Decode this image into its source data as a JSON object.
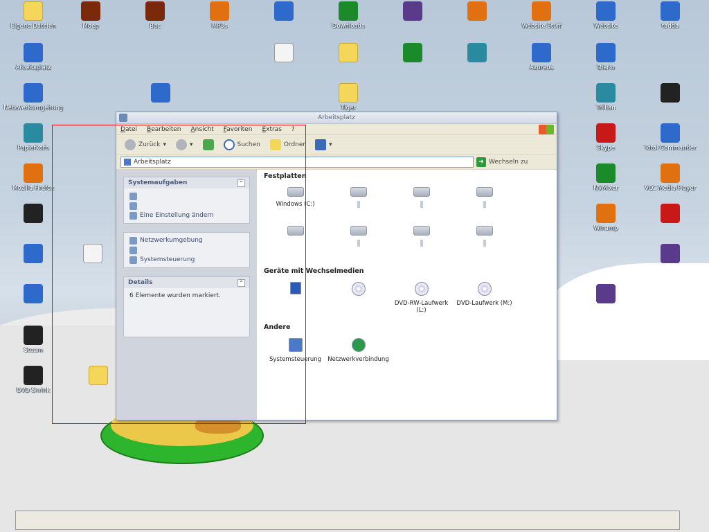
{
  "desktop": {
    "icons": [
      {
        "name": "eigene-dateien-icon",
        "label": "Eigene Dateien",
        "color": "c-folder"
      },
      {
        "name": "moep-icon",
        "label": "Moep",
        "color": "c-game"
      },
      {
        "name": "bac-icon",
        "label": "Bac",
        "color": "c-game"
      },
      {
        "name": "mp3s-icon",
        "label": "MP3s",
        "color": "c-orange"
      },
      {
        "name": "dvd-files-icon",
        "label": "",
        "color": "c-blue"
      },
      {
        "name": "downloads-icon",
        "label": "Downloads",
        "color": "c-green"
      },
      {
        "name": "cinema-4d-zeugs-icon",
        "label": "",
        "color": "c-purple"
      },
      {
        "name": "photoshop-zeugs-icon",
        "label": "",
        "color": "c-orange"
      },
      {
        "name": "website-stuff-icon",
        "label": "Website Stuff",
        "color": "c-orange"
      },
      {
        "name": "website-icon",
        "label": "Website",
        "color": "c-blue"
      },
      {
        "name": "tadda-icon",
        "label": "tadda",
        "color": "c-blue"
      },
      {
        "name": "arbeitsplatz-icon",
        "label": "Arbeitsplatz",
        "color": "c-blue"
      },
      {
        "name": "lol-dateien-icon",
        "label": "",
        "color": "c-white"
      },
      {
        "name": "geplante-anschaffungen-icon",
        "label": "",
        "color": "c-folder"
      },
      {
        "name": "cinema-4d-files-icon",
        "label": "",
        "color": "c-green"
      },
      {
        "name": "flashfxp-icon",
        "label": "",
        "color": "c-teal"
      },
      {
        "name": "azureus-icon",
        "label": "Azureus",
        "color": "c-blue"
      },
      {
        "name": "diario-icon",
        "label": "Diario",
        "color": "c-blue"
      },
      {
        "name": "netzwerkumgebung-icon",
        "label": "Netzwerkumgebung",
        "color": "c-blue"
      },
      {
        "name": "grafikencoder-icon",
        "label": "",
        "color": "c-blue"
      },
      {
        "name": "tiger-icon",
        "label": "Tiger",
        "color": "c-folder"
      },
      {
        "name": "trillian-icon",
        "label": "Trillian",
        "color": "c-teal"
      },
      {
        "name": "sachen-fuer-prjc-icon",
        "label": "",
        "color": "c-dark"
      },
      {
        "name": "papierkorb-icon",
        "label": "Papierkorb",
        "color": "c-teal"
      },
      {
        "name": "skype-icon",
        "label": "Skype",
        "color": "c-red"
      },
      {
        "name": "total-commander-icon",
        "label": "Total Commander",
        "color": "c-blue"
      },
      {
        "name": "mozilla-firefox-icon",
        "label": "Mozilla Firefox",
        "color": "c-orange"
      },
      {
        "name": "nvmixer-icon",
        "label": "NVMixer",
        "color": "c-green"
      },
      {
        "name": "vlc-icon",
        "label": "VLC Media Player",
        "color": "c-orange"
      },
      {
        "name": "gs-sachen-icon",
        "label": "",
        "color": "c-dark"
      },
      {
        "name": "winamp-icon",
        "label": "Winamp",
        "color": "c-orange"
      },
      {
        "name": "gjex-icon",
        "label": "",
        "color": "c-red"
      },
      {
        "name": "tuneup-icon",
        "label": "",
        "color": "c-blue"
      },
      {
        "name": "word-doc-icon",
        "label": "",
        "color": "c-white"
      },
      {
        "name": "winrar-icon",
        "label": "",
        "color": "c-purple"
      },
      {
        "name": "safeware-icon",
        "label": "",
        "color": "c-blue"
      },
      {
        "name": "glory-icon",
        "label": "",
        "color": "c-purple"
      },
      {
        "name": "steam-icon",
        "label": "Steam",
        "color": "c-dark"
      },
      {
        "name": "dvd-shrink-icon",
        "label": "DVD Shrink",
        "color": "c-dark"
      },
      {
        "name": "folder-loader-icon",
        "label": "",
        "color": "c-folder"
      }
    ]
  },
  "window": {
    "title": "Arbeitsplatz",
    "menu": [
      "Datei",
      "Bearbeiten",
      "Ansicht",
      "Favoriten",
      "Extras",
      "?"
    ],
    "toolbar": {
      "back": "Zurück",
      "search": "Suchen",
      "folders": "Ordner"
    },
    "address": {
      "value": "Arbeitsplatz",
      "go": "Wechseln zu"
    },
    "taskpane": {
      "system_title": "Systemaufgaben",
      "system_items": [
        "",
        "",
        "Eine Einstellung ändern"
      ],
      "other_items": [
        "Netzwerkumgebung",
        "",
        "Systemsteuerung"
      ],
      "details_title": "Details",
      "details_text": "6 Elemente wurden markiert."
    },
    "groups": [
      {
        "title": "Festplatten",
        "items": [
          {
            "label": "Windows (C:)",
            "sel": false,
            "type": ""
          },
          {
            "label": "",
            "sel": true,
            "type": ""
          },
          {
            "label": "",
            "sel": true,
            "type": ""
          },
          {
            "label": "",
            "sel": true,
            "type": ""
          },
          {
            "label": "",
            "sel": false,
            "type": ""
          },
          {
            "label": "",
            "sel": true,
            "type": ""
          },
          {
            "label": "",
            "sel": true,
            "type": ""
          },
          {
            "label": "",
            "sel": true,
            "type": ""
          }
        ]
      },
      {
        "title": "Geräte mit Wechselmedien",
        "items": [
          {
            "label": "",
            "sel": false,
            "type": "flop"
          },
          {
            "label": "",
            "sel": false,
            "type": "cd"
          },
          {
            "label": "DVD-RW-Laufwerk (L:)",
            "sel": false,
            "type": "cd"
          },
          {
            "label": "DVD-Laufwerk (M:)",
            "sel": false,
            "type": "cd"
          }
        ]
      },
      {
        "title": "Andere",
        "items": [
          {
            "label": "Systemsteuerung",
            "sel": false,
            "type": "sys"
          },
          {
            "label": "Netzwerkverbindung",
            "sel": false,
            "type": "net"
          }
        ]
      }
    ]
  },
  "taskbar": {
    "rows": [
      [
        "",
        "",
        "",
        "",
        ""
      ],
      [
        "",
        "",
        "",
        "",
        ""
      ]
    ]
  }
}
